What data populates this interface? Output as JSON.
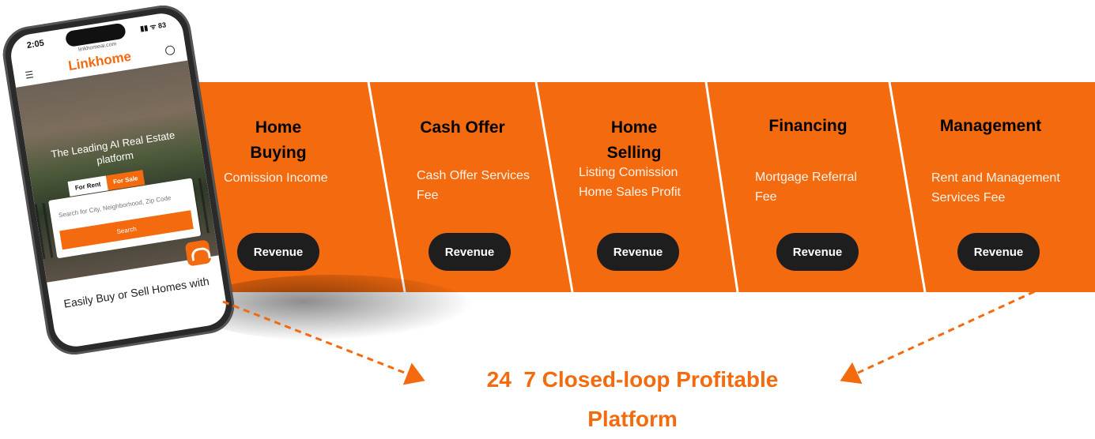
{
  "phone": {
    "time": "2:05",
    "status_icons": "▮▮ ᯤ 83",
    "url": "linkhomeai.com",
    "logo": "Linkhome",
    "hero_text": "The Leading AI Real Estate platform",
    "tab_rent": "For Rent",
    "tab_sale": "For Sale",
    "search_placeholder": "Search for City, Neighborhood, Zip Code",
    "search_button": "Search",
    "tagline": "Easily Buy or Sell Homes with"
  },
  "panels": [
    {
      "title": "Home Buying",
      "desc": "Comission Income",
      "button": "Revenue"
    },
    {
      "title": "Cash Offer",
      "desc": "Cash Offer Services Fee",
      "button": "Revenue"
    },
    {
      "title": "Home Selling",
      "desc": "Listing Comission Home Sales Profit",
      "button": "Revenue"
    },
    {
      "title": "Financing",
      "desc": "Mortgage Referral Fee",
      "button": "Revenue"
    },
    {
      "title": "Management",
      "desc": "Rent and Management Services Fee",
      "button": "Revenue"
    }
  ],
  "footer": {
    "line1": "24  7 Closed-loop Profitable",
    "line2": "Platform"
  },
  "colors": {
    "accent": "#f36a0f",
    "button": "#1e1e1e"
  }
}
